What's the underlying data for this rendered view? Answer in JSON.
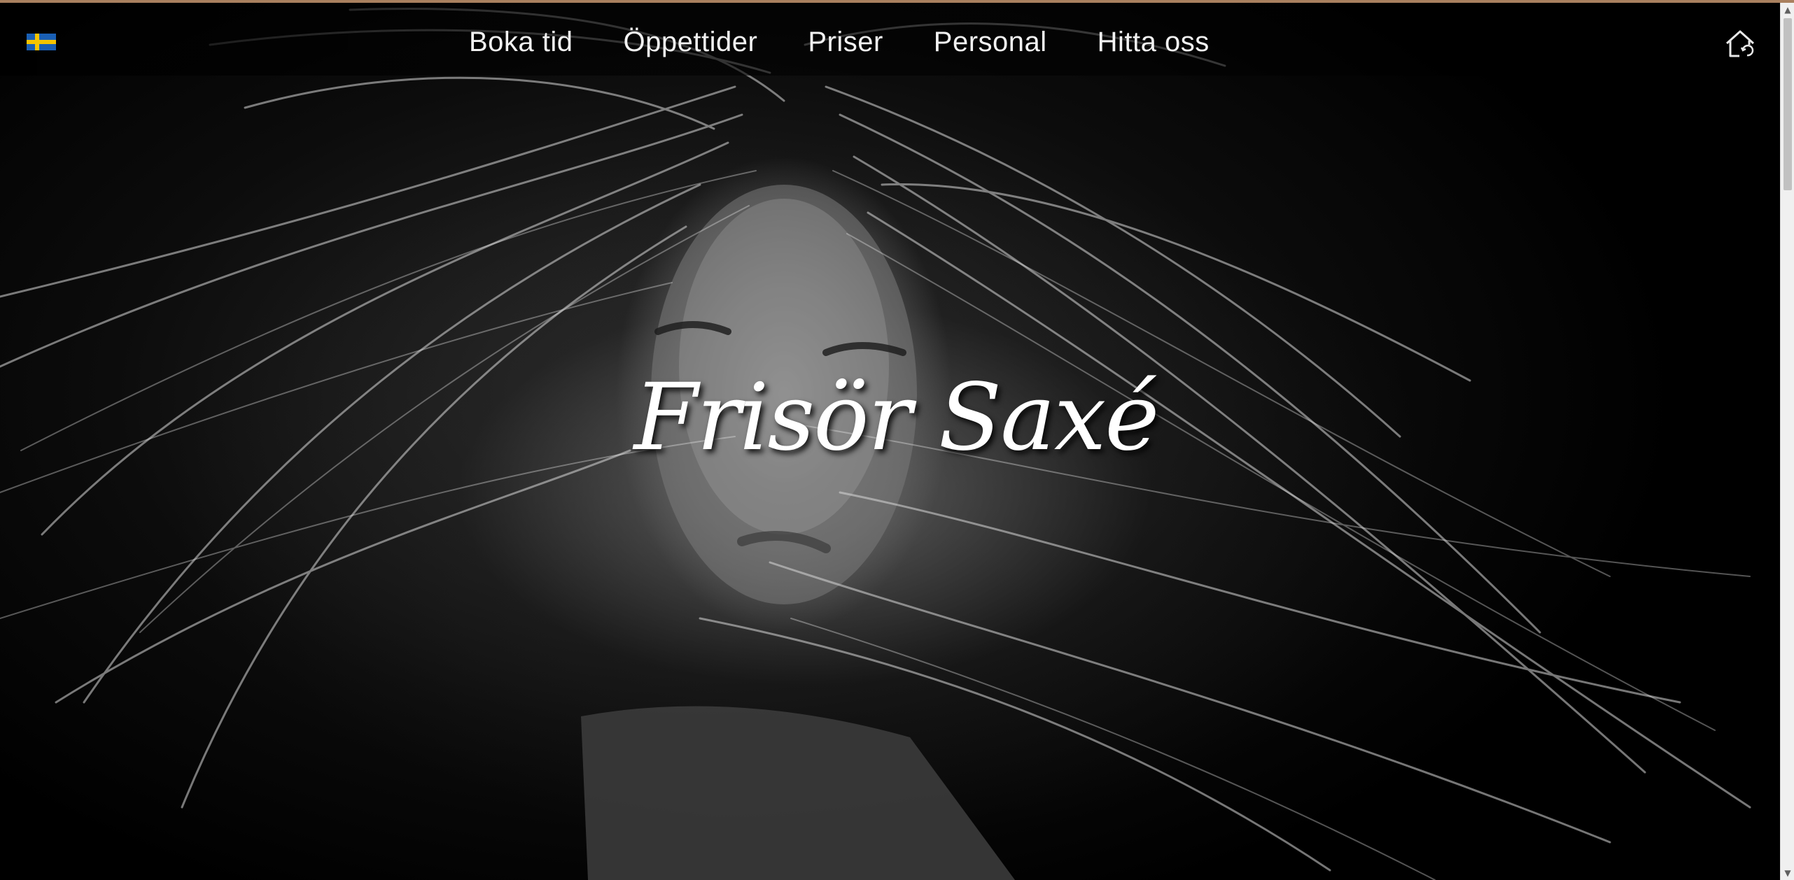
{
  "header": {
    "language_flag": "swedish-flag",
    "nav": {
      "items": [
        {
          "label": "Boka tid"
        },
        {
          "label": "Öppettider"
        },
        {
          "label": "Priser"
        },
        {
          "label": "Personal"
        },
        {
          "label": "Hitta oss"
        }
      ]
    },
    "home_icon": "home-icon"
  },
  "hero": {
    "title": "Frisör Saxé",
    "image": "black-and-white portrait of woman with wind-blown hair"
  },
  "colors": {
    "nav_text": "#f2f2f2",
    "title_text": "#ffffff",
    "flag_blue": "#1a5fb4",
    "flag_yellow": "#f5c400",
    "top_border": "#a9805f"
  }
}
